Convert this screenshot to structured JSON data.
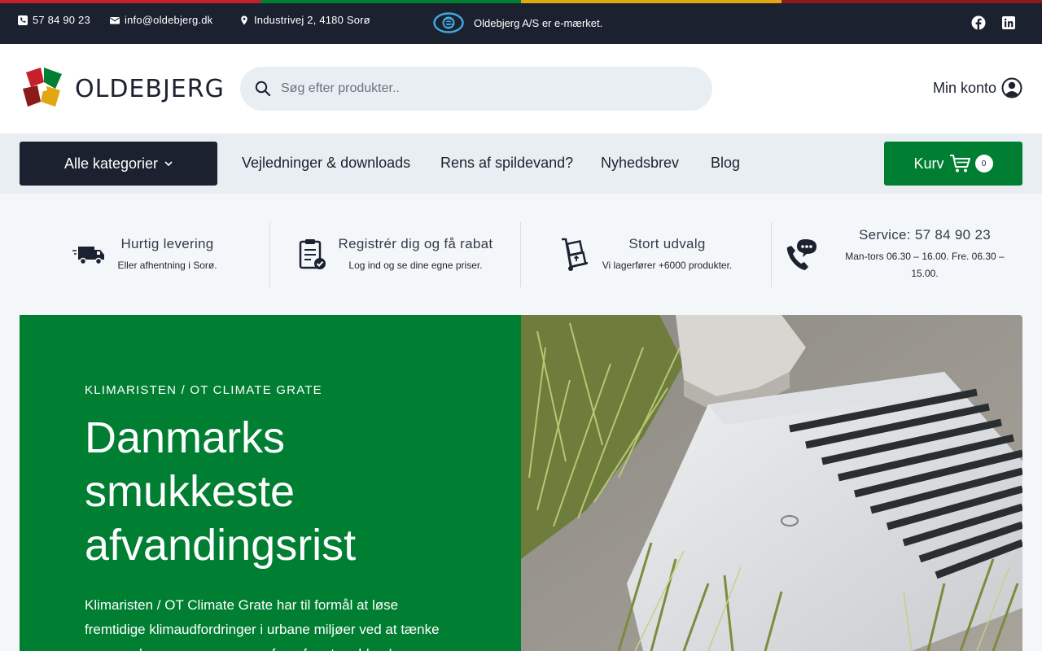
{
  "topbar": {
    "phone": "57 84 90 23",
    "email": "info@oldebjerg.dk",
    "address": "Industrivej 2, 4180 Sorø",
    "emark_text": "Oldebjerg A/S er e-mærket."
  },
  "stripe_colors": [
    "#c7202a",
    "#007f33",
    "#e2a613",
    "#8b1a1a"
  ],
  "header": {
    "brand": "OLDEBJERG",
    "search_placeholder": "Søg efter produkter..",
    "account_label": "Min konto"
  },
  "nav": {
    "categories_label": "Alle kategorier",
    "links": [
      "Vejledninger & downloads",
      "Rens af spildevand?",
      "Nyhedsbrev",
      "Blog"
    ],
    "cart_label": "Kurv",
    "cart_count": "0"
  },
  "usps": [
    {
      "title": "Hurtig levering",
      "subtitle": "Eller afhentning i Sorø.",
      "icon": "delivery-truck-icon"
    },
    {
      "title": "Registrér dig og få rabat",
      "subtitle": "Log ind og se dine egne priser.",
      "icon": "clipboard-check-icon"
    },
    {
      "title": "Stort udvalg",
      "subtitle": "Vi lagerfører +6000 produkter.",
      "icon": "hand-truck-icon"
    },
    {
      "title": "Service: 57 84 90 23",
      "subtitle": "Man-tors 06.30 – 16.00. Fre. 06.30 – 15.00.",
      "icon": "phone-chat-icon"
    }
  ],
  "hero": {
    "eyebrow": "KLIMARISTEN / OT CLIMATE GRATE",
    "heading": "Danmarks smukkeste afvandingsrist",
    "body": "Klimaristen / OT Climate Grate har til formål at løse fremtidige klimaudfordringer i urbane miljøer ved at tænke regnvand som en ressource – frem for et problem!"
  },
  "colors": {
    "dark": "#1c2130",
    "brand_green": "#007f33",
    "nav_bg": "#e9eef3"
  }
}
